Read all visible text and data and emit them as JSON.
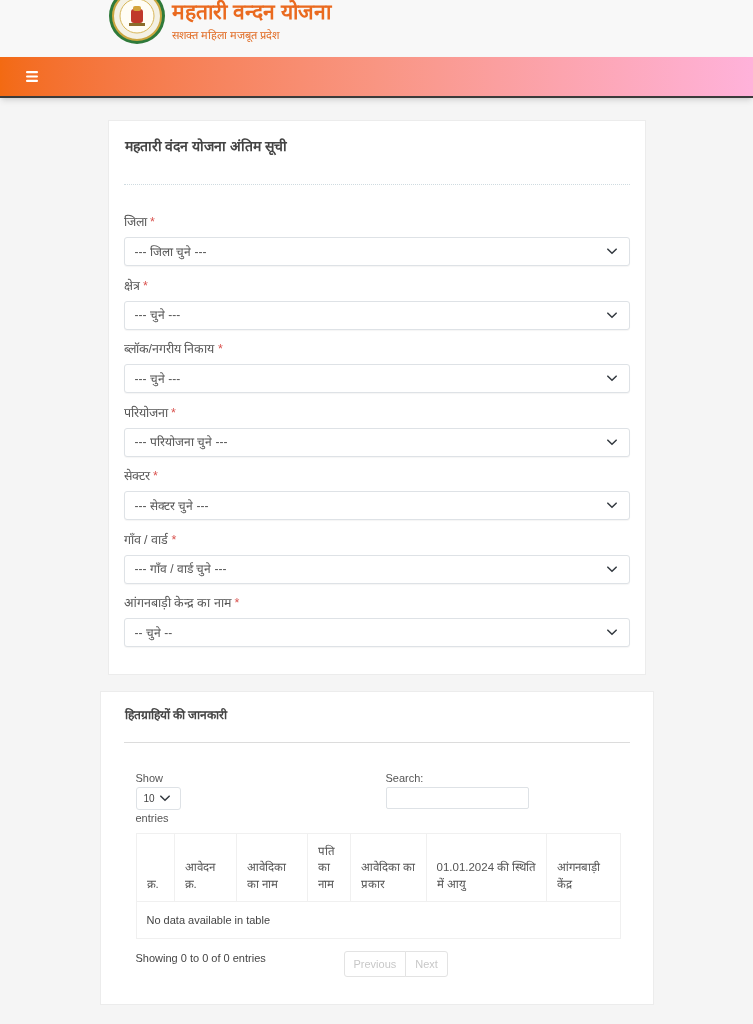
{
  "header": {
    "title": "महतारी वन्दन योजना",
    "tagline": "सशक्त महिला मजबूत प्रदेश"
  },
  "filter_card": {
    "title": "महतारी वंदन योजना अंतिम सूची",
    "fields": [
      {
        "label": "जिला",
        "required_mark": "*",
        "value": "--- जिला चुने ---"
      },
      {
        "label": "क्षेत्र",
        "required_mark": "*",
        "value": "--- चुने ---"
      },
      {
        "label": "ब्लॉक/नगरीय निकाय",
        "required_mark": "*",
        "value": "--- चुने ---"
      },
      {
        "label": "परियोजना",
        "required_mark": "*",
        "value": "--- परियोजना चुने ---"
      },
      {
        "label": "सेक्टर",
        "required_mark": "*",
        "value": "--- सेक्टर चुने ---"
      },
      {
        "label": "गाँव / वार्ड",
        "required_mark": "*",
        "value": "--- गाँव / वार्ड चुने ---"
      },
      {
        "label": "आंगनबाड़ी केन्द्र का नाम",
        "required_mark": "*",
        "value": "-- चुने --"
      }
    ]
  },
  "beneficiary_card": {
    "title": "हितग्राहियों की जानकारी",
    "length_menu": {
      "label": "Show",
      "value": "10",
      "suffix": "entries"
    },
    "search": {
      "label": "Search:"
    },
    "table": {
      "columns": [
        "क्र.",
        "आवेदन क्र.",
        "आवेदिका का नाम",
        "पति का नाम",
        "आवेदिका का प्रकार",
        "01.01.2024 की स्थिति में आयु",
        "आंगनबाड़ी केंद्र"
      ],
      "empty_message": "No data available in table"
    },
    "info": "Showing 0 to 0 of 0 entries",
    "pagination": [
      {
        "label": "Previous",
        "disabled": true
      },
      {
        "label": "Next",
        "disabled": true
      }
    ]
  }
}
